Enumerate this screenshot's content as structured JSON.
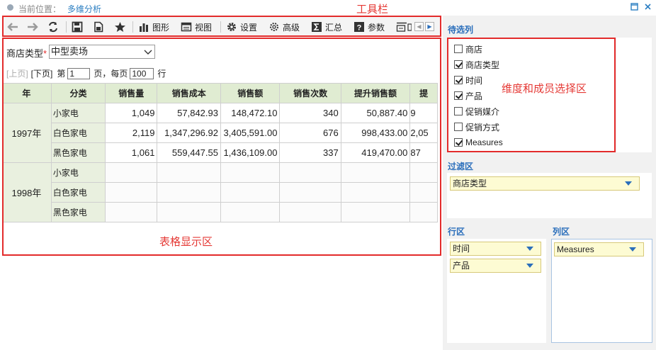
{
  "location": {
    "label": "当前位置：",
    "value": "多维分析"
  },
  "annotations": {
    "toolbar": "工具栏",
    "table_area": "表格显示区",
    "member_area": "维度和成员选择区"
  },
  "toolbar": {
    "items": [
      {
        "key": "chart",
        "label": "图形"
      },
      {
        "key": "view",
        "label": "视图"
      },
      {
        "key": "settings",
        "label": "设置"
      },
      {
        "key": "advanced",
        "label": "高级"
      },
      {
        "key": "summary",
        "label": "汇总"
      },
      {
        "key": "params",
        "label": "参数"
      }
    ]
  },
  "filter_bar": {
    "label": "商店类型",
    "required_mark": "*",
    "selected": "中型卖场"
  },
  "pager": {
    "prev": "[上页]",
    "next": "[下页]",
    "page_prefix": "第",
    "page_value": "1",
    "page_suffix": "页，每页",
    "size_value": "100",
    "size_suffix": "行"
  },
  "table": {
    "headers": [
      "年",
      "分类",
      "销售量",
      "销售成本",
      "销售额",
      "销售次数",
      "提升销售额",
      "提"
    ],
    "years": [
      "1997年",
      "1998年"
    ],
    "categories": [
      "小家电",
      "白色家电",
      "黑色家电"
    ],
    "rows_1997": [
      [
        "1,049",
        "57,842.93",
        "148,472.10",
        "340",
        "50,887.40",
        "9"
      ],
      [
        "2,119",
        "1,347,296.92",
        "3,405,591.00",
        "676",
        "998,433.00",
        "2,05"
      ],
      [
        "1,061",
        "559,447.55",
        "1,436,109.00",
        "337",
        "419,470.00",
        "87"
      ]
    ]
  },
  "right_panel": {
    "candidates_title": "待选列",
    "members": [
      {
        "label": "商店",
        "checked": false
      },
      {
        "label": "商店类型",
        "checked": true
      },
      {
        "label": "时间",
        "checked": true
      },
      {
        "label": "产品",
        "checked": true
      },
      {
        "label": "促销媒介",
        "checked": false
      },
      {
        "label": "促销方式",
        "checked": false
      },
      {
        "label": "Measures",
        "checked": true
      }
    ],
    "filter_title": "过滤区",
    "filter_chip": "商店类型",
    "row_title": "行区",
    "row_chips": [
      "时间",
      "产品"
    ],
    "col_title": "列区",
    "col_chips": [
      "Measures"
    ]
  },
  "colors": {
    "accent_red": "#e32b2b",
    "link_blue": "#2a6ebb",
    "header_green": "#e0ecd2",
    "chip_yellow": "#fdfbd3"
  }
}
